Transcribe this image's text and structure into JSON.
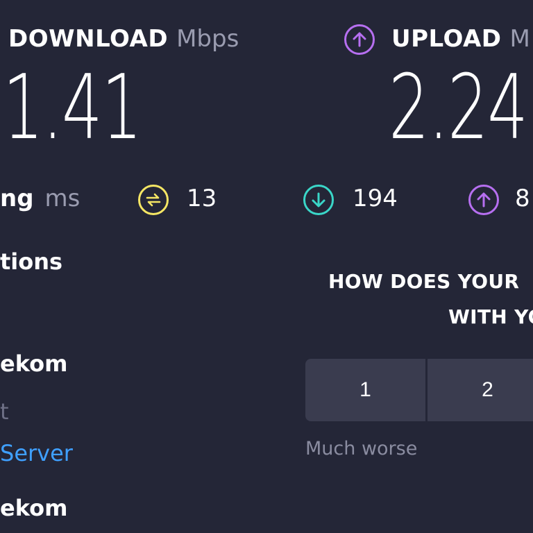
{
  "download": {
    "label": "DOWNLOAD",
    "unit": "Mbps",
    "value": "1.41"
  },
  "upload": {
    "label": "UPLOAD",
    "unit": "M",
    "value": "2.24"
  },
  "ping": {
    "label_partial": "ng",
    "unit": "ms",
    "idle_value": "13",
    "download_value": "194",
    "upload_value_partial": "8"
  },
  "connections": {
    "label_partial": "tions",
    "provider_1_partial": "ekom",
    "location_partial": "t",
    "change_server_partial": "Server",
    "provider_2_partial": "ekom"
  },
  "feedback": {
    "question_line1": "HOW DOES YOUR",
    "question_line2": "WITH YO",
    "ratings": [
      "1",
      "2"
    ],
    "low_label": "Much worse"
  },
  "colors": {
    "background": "#242637",
    "download_accent": "#3ad6c8",
    "upload_accent": "#b66ff0",
    "ping_accent": "#f5e664",
    "link": "#3fa0ff",
    "button_bg": "#3a3c4f"
  },
  "icons": {
    "upload_header": "upload-arrow-icon",
    "ping": "ping-jitter-icon",
    "download_latency": "download-arrow-icon",
    "upload_latency": "upload-arrow-icon"
  }
}
